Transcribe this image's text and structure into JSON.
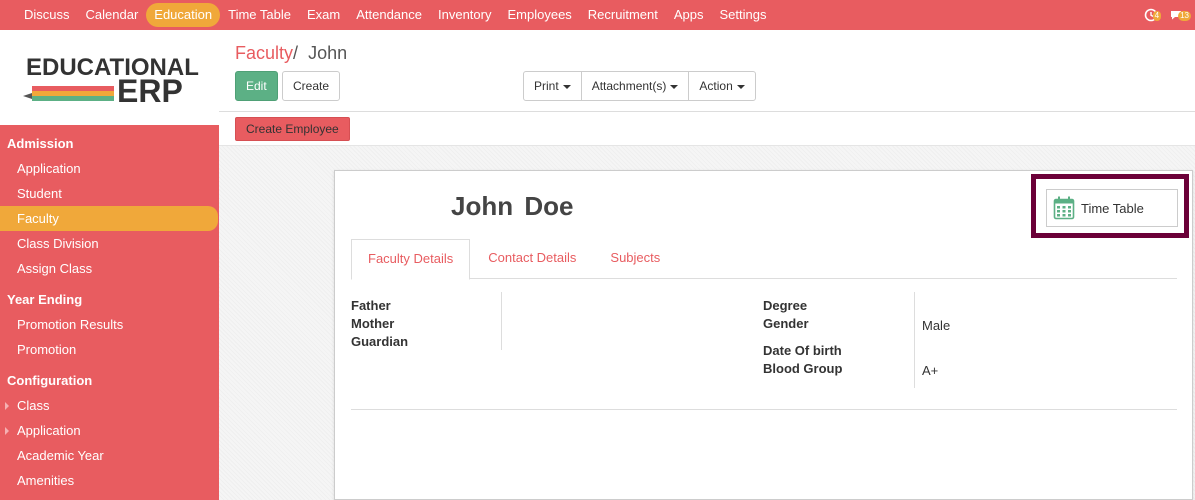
{
  "topbar": {
    "menu": [
      "Discuss",
      "Calendar",
      "Education",
      "Time Table",
      "Exam",
      "Attendance",
      "Inventory",
      "Employees",
      "Recruitment",
      "Apps",
      "Settings"
    ],
    "active_index": 2,
    "activity_badge": "4",
    "messages_badge": "13"
  },
  "sidebar": {
    "logo_line1": "EDUCATIONAL",
    "logo_line2": "ERP",
    "sections": [
      {
        "title": "Admission",
        "items": [
          "Application",
          "Student",
          "Faculty",
          "Class Division",
          "Assign Class"
        ]
      },
      {
        "title": "Year Ending",
        "items": [
          "Promotion Results",
          "Promotion"
        ]
      },
      {
        "title": "Configuration",
        "items": [
          "Class",
          "Application",
          "Academic Year",
          "Amenities"
        ]
      }
    ],
    "active_item": "Faculty"
  },
  "control": {
    "breadcrumb_parent": "Faculty",
    "breadcrumb_sep": "/",
    "breadcrumb_current": "John",
    "edit_label": "Edit",
    "create_label": "Create",
    "print_label": "Print",
    "attachments_label": "Attachment(s)",
    "action_label": "Action"
  },
  "status": {
    "create_employee_label": "Create Employee"
  },
  "form": {
    "first_name": "John",
    "last_name": "Doe",
    "timetable_label": "Time Table",
    "tabs": [
      "Faculty Details",
      "Contact Details",
      "Subjects"
    ],
    "left_fields": [
      "Father",
      "Mother",
      "Guardian"
    ],
    "right_fields": {
      "degree": "Degree",
      "gender": "Gender",
      "gender_value": "Male",
      "dob": "Date Of birth",
      "blood_group": "Blood Group",
      "blood_group_value": "A+"
    }
  },
  "colors": {
    "primary": "#e85c60",
    "accent": "#f0a83a",
    "edit": "#5cb085",
    "highlight": "#6b0038"
  }
}
